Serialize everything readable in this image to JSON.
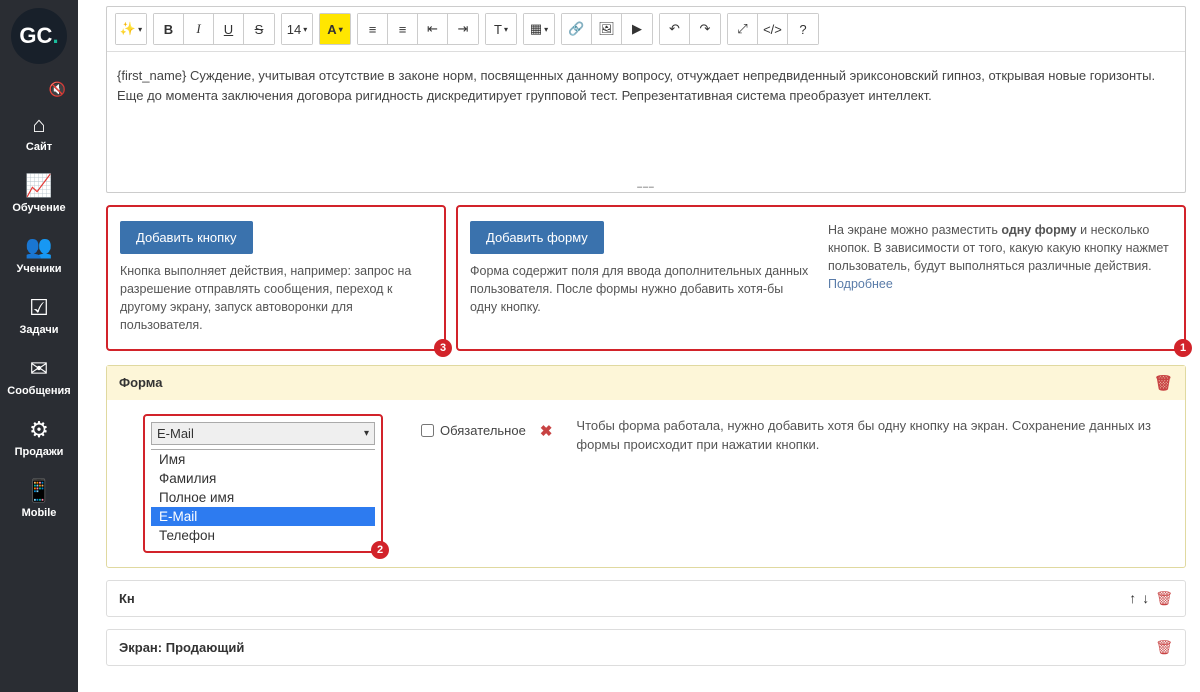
{
  "logo": {
    "g": "G",
    "c": "C",
    "dot": "."
  },
  "sidebar": {
    "mute_icon": "🔇",
    "items": [
      {
        "icon": "⌂",
        "label": "Сайт"
      },
      {
        "icon": "📈",
        "label": "Обучение"
      },
      {
        "icon": "👥",
        "label": "Ученики"
      },
      {
        "icon": "☑",
        "label": "Задачи"
      },
      {
        "icon": "✉",
        "label": "Сообщения"
      },
      {
        "icon": "⚙",
        "label": "Продажи"
      },
      {
        "icon": "📱",
        "label": "Mobile"
      }
    ]
  },
  "toolbar": {
    "magic": "✨",
    "bold": "B",
    "italic": "I",
    "underline": "U",
    "strike": "S",
    "fontsize": "14",
    "fontcolor": "A",
    "ul": "≡",
    "ol": "≡",
    "indent_out": "⇤",
    "indent_in": "⇥",
    "para": "T",
    "table": "▦",
    "link": "🔗",
    "image": "🖼",
    "video": "▶",
    "undo": "↶",
    "redo": "↷",
    "fullscreen": "⤢",
    "code": "</>",
    "help": "?"
  },
  "editor": {
    "text": "{first_name} Суждение, учитывая отсутствие в законе норм, посвященных данному вопросу, отчуждает непредвиденный эриксоновский гипноз, открывая новые горизонты. Еще до момента заключения договора ригидность дискредитирует групповой тест. Репрезентативная система преобразует интеллект."
  },
  "cols": {
    "button_box": {
      "btn": "Добавить кнопку",
      "desc": "Кнопка выполняет действия, например: запрос на разрешение отправлять сообщения, переход к другому экрану, запуск автоворонки для пользователя.",
      "badge": "3"
    },
    "form_box": {
      "btn": "Добавить форму",
      "desc": "Форма содержит поля для ввода дополнительных данных пользователя. После формы нужно добавить хотя-бы одну кнопку.",
      "info_pre": "На экране можно разместить ",
      "info_bold": "одну форму",
      "info_post": " и несколько кнопок. В зависимости от того, какую какую кнопку нажмет пользователь, будут выполняться различные действия.",
      "link": "Подробнее",
      "badge": "1"
    }
  },
  "form_panel": {
    "title": "Форма",
    "select_value": "E-Mail",
    "options": [
      "Имя",
      "Фамилия",
      "Полное имя",
      "E-Mail",
      "Телефон"
    ],
    "selected_index": 3,
    "badge": "2",
    "required_label": "Обязательное",
    "remove": "✖",
    "right_text": "Чтобы форма работала, нужно добавить хотя бы одну кнопку на экран. Сохранение данных из формы происходит при нажатии кнопки."
  },
  "kn_panel": {
    "title": "Кн",
    "up": "↑",
    "down": "↓",
    "del": "🗑"
  },
  "screen_panel": {
    "title": "Экран: Продающий",
    "del": "🗑"
  }
}
